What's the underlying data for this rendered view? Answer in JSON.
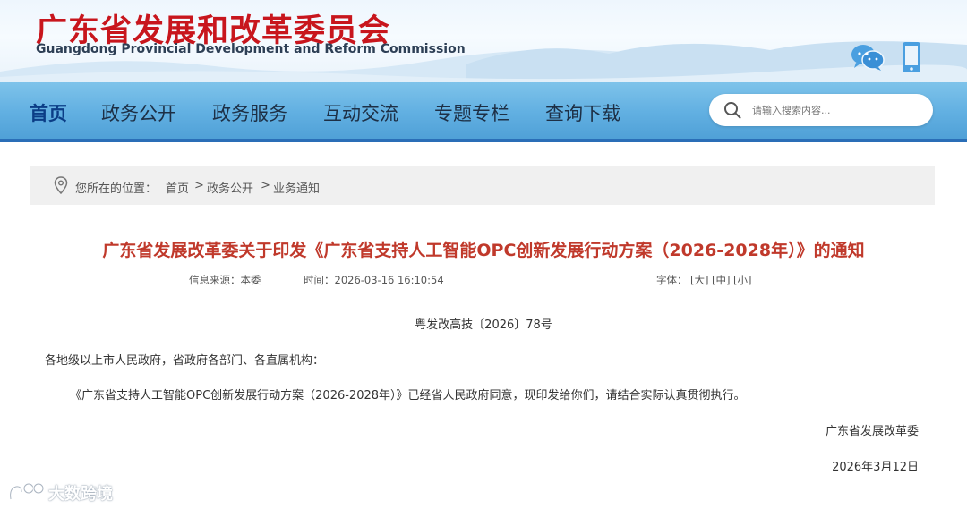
{
  "header": {
    "title": "广东省发展和改革委员会",
    "subtitle": "Guangdong Provincial Development and Reform Commission",
    "icons": [
      "wechat-icon",
      "mobile-phone-icon"
    ]
  },
  "nav": {
    "items": [
      "首页",
      "政务公开",
      "政务服务",
      "互动交流",
      "专题专栏",
      "查询下载"
    ],
    "active_index": 0,
    "search_placeholder": "请输入搜索内容..."
  },
  "breadcrumb": {
    "prefix": "您所在的位置：",
    "items": [
      "首页",
      "政务公开",
      "业务通知"
    ],
    "separator": ">"
  },
  "article": {
    "title": "广东省发展改革委关于印发《广东省支持人工智能OPC创新发展行动方案（2026-2028年）》的通知",
    "source": "信息来源：本委",
    "time": "时间：2026-03-16 16:10:54",
    "font_label": "字体：",
    "font_sizes": [
      "[大]",
      "[中]",
      "[小]"
    ],
    "doc_number": "粤发改高技〔2026〕78号",
    "salutation": "各地级以上市人民政府，省政府各部门、各直属机构：",
    "body": "《广东省支持人工智能OPC创新发展行动方案（2026-2028年）》已经省人民政府同意，现印发给你们，请结合实际认真贯彻执行。",
    "signature": "广东省发展改革委",
    "date": "2026年3月12日"
  },
  "watermark": {
    "text": "大数跨境"
  },
  "colors": {
    "title_red": "#c8161d",
    "article_title_red": "#c0392b",
    "nav_blue": "#62b0e2",
    "nav_active": "#0b3d86",
    "nav_border": "#2a6eb7"
  }
}
